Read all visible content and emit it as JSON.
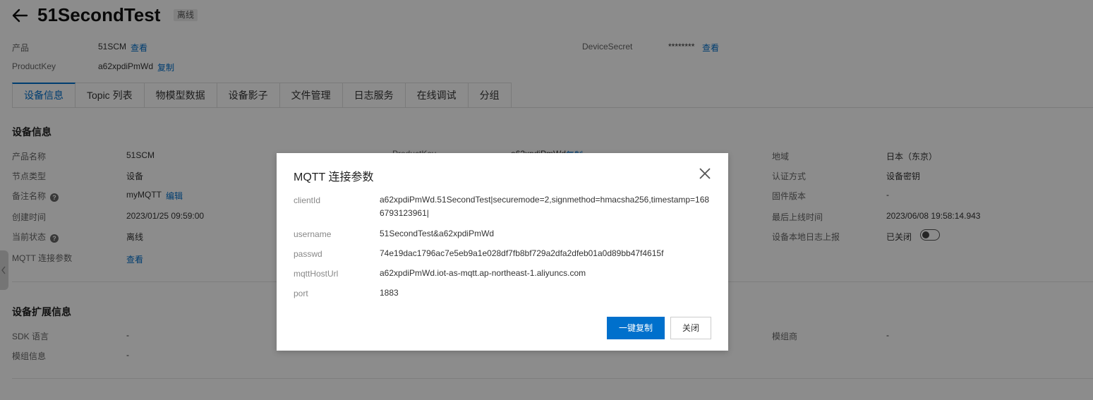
{
  "header": {
    "title": "51SecondTest",
    "status_badge": "离线"
  },
  "meta": {
    "product_label": "产品",
    "product_value": "51SCM",
    "product_link": "查看",
    "productkey_label": "ProductKey",
    "productkey_value": "a62xpdiPmWd",
    "productkey_link": "复制",
    "devicesecret_label": "DeviceSecret",
    "devicesecret_value": "********",
    "devicesecret_link": "查看"
  },
  "tabs": [
    {
      "label": "设备信息",
      "active": true
    },
    {
      "label": "Topic 列表"
    },
    {
      "label": "物模型数据"
    },
    {
      "label": "设备影子"
    },
    {
      "label": "文件管理"
    },
    {
      "label": "日志服务"
    },
    {
      "label": "在线调试"
    },
    {
      "label": "分组"
    }
  ],
  "device_info": {
    "section_title": "设备信息",
    "left": [
      {
        "label": "产品名称",
        "value": "51SCM"
      },
      {
        "label": "节点类型",
        "value": "设备"
      },
      {
        "label": "备注名称",
        "value": "myMQTT",
        "link": "编辑"
      },
      {
        "label": "创建时间",
        "value": "2023/01/25 09:59:00"
      },
      {
        "label": "当前状态",
        "value": "离线"
      },
      {
        "label": "MQTT 连接参数",
        "link": "查看"
      }
    ],
    "mid_partial": {
      "label": "ProductKey",
      "value": "a62xpdiPmWd",
      "link": "复制"
    },
    "right": [
      {
        "label": "地域",
        "value": "日本（东京）"
      },
      {
        "label": "认证方式",
        "value": "设备密钥"
      },
      {
        "label": "固件版本",
        "value": "-"
      },
      {
        "label": "最后上线时间",
        "value": "2023/06/08 19:58:14.943"
      },
      {
        "label": "设备本地日志上报",
        "value": "已关闭",
        "toggle_on": false
      }
    ]
  },
  "ext_info": {
    "section_title": "设备扩展信息",
    "rows": [
      {
        "label": "SDK 语言",
        "value": "-"
      },
      {
        "label": "模组信息",
        "value": "-"
      }
    ],
    "right": {
      "label": "模组商",
      "value": "-"
    }
  },
  "modal": {
    "title": "MQTT 连接参数",
    "fields": [
      {
        "label": "clientId",
        "value": "a62xpdiPmWd.51SecondTest|securemode=2,signmethod=hmacsha256,timestamp=1686793123961|"
      },
      {
        "label": "username",
        "value": "51SecondTest&a62xpdiPmWd"
      },
      {
        "label": "passwd",
        "value": "74e19dac1796ac7e5eb9a1e028df7fb8bf729a2dfa2dfeb01a0d89bb47f4615f"
      },
      {
        "label": "mqttHostUrl",
        "value": "a62xpdiPmWd.iot-as-mqtt.ap-northeast-1.aliyuncs.com"
      },
      {
        "label": "port",
        "value": "1883"
      }
    ],
    "copy_all_button": "一键复制",
    "close_button": "关闭"
  },
  "colors": {
    "accent": "#0070cc",
    "overlay": "rgba(0,0,0,0.45)"
  }
}
